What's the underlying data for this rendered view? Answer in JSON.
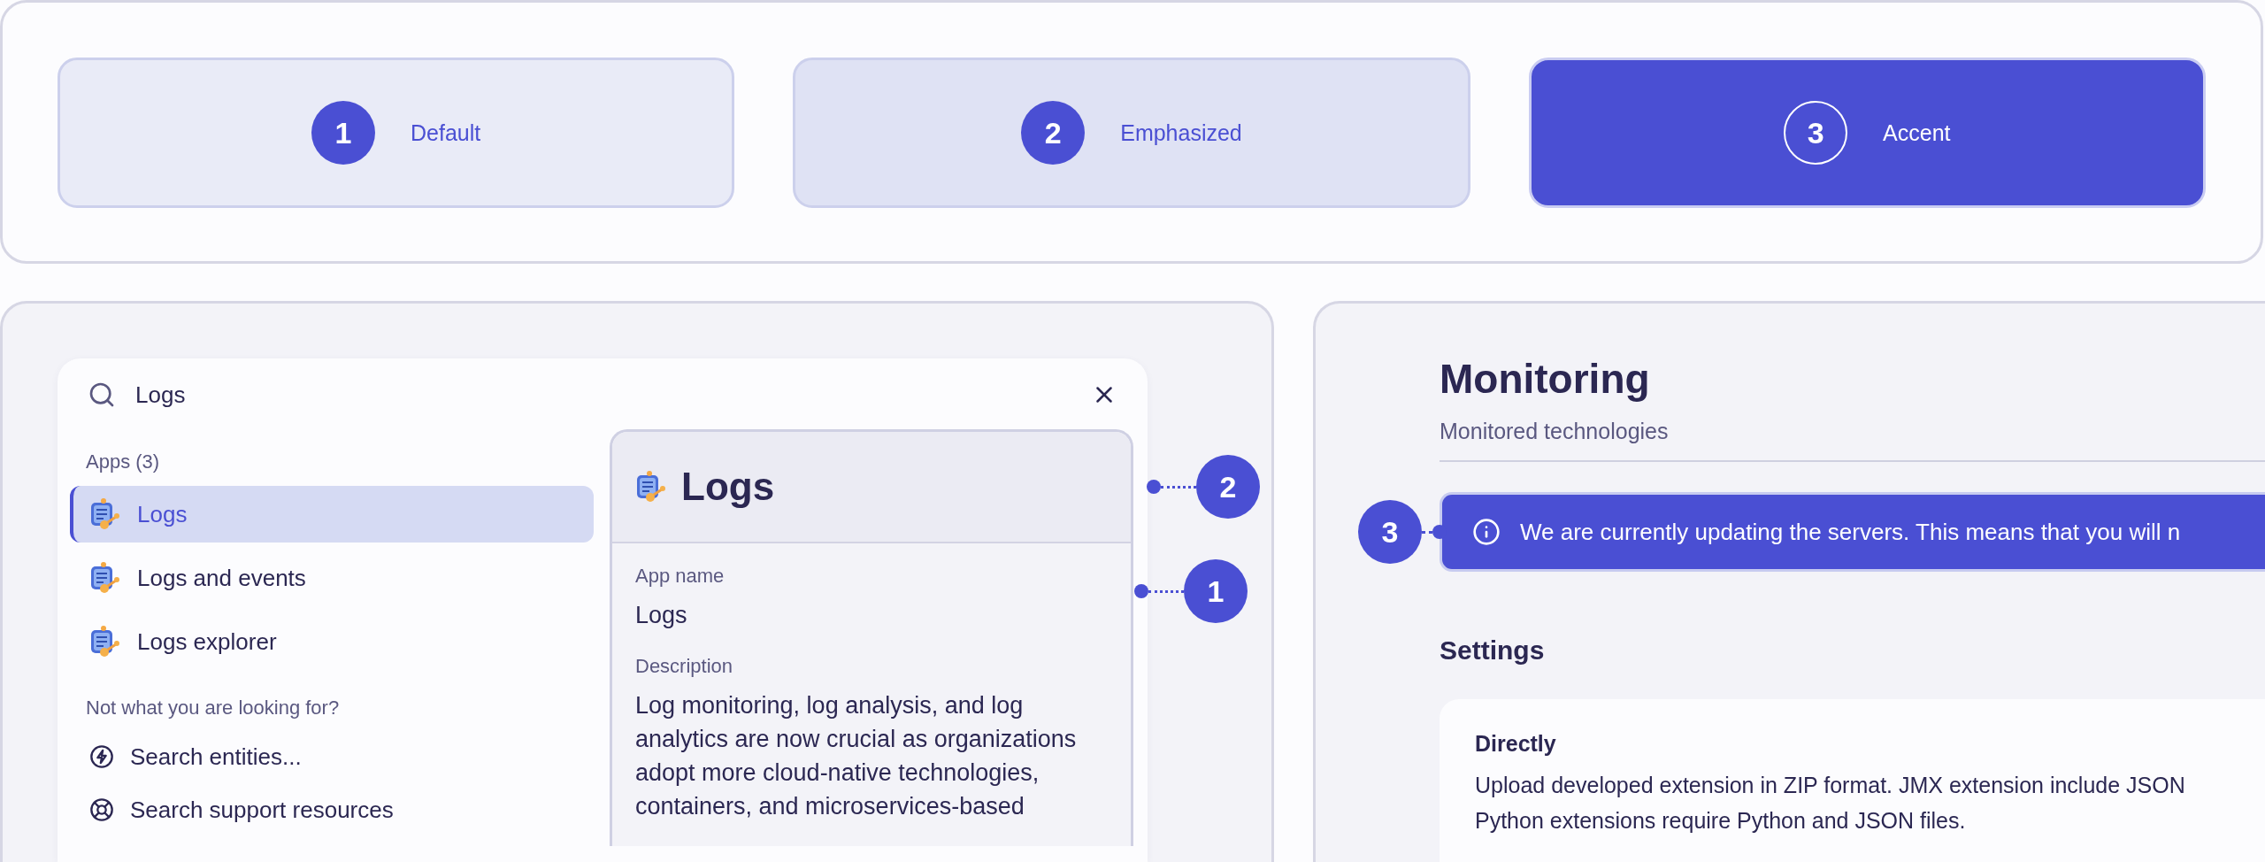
{
  "variants": [
    {
      "number": "1",
      "label": "Default",
      "kind": "default"
    },
    {
      "number": "2",
      "label": "Emphasized",
      "kind": "emphasized"
    },
    {
      "number": "3",
      "label": "Accent",
      "kind": "accent"
    }
  ],
  "search_dialog": {
    "query": "Logs",
    "section_title": "Apps (3)",
    "apps": [
      {
        "label": "Logs",
        "selected": true
      },
      {
        "label": "Logs and events",
        "selected": false
      },
      {
        "label": "Logs explorer",
        "selected": false
      }
    ],
    "fallback_title": "Not what you are looking for?",
    "actions": [
      {
        "label": "Search entities...",
        "kind": "entities"
      },
      {
        "label": "Search support resources",
        "kind": "support"
      }
    ]
  },
  "detail_card": {
    "title": "Logs",
    "callout": "2",
    "fields": [
      {
        "label": "App name",
        "value": "Logs",
        "callout": "1"
      },
      {
        "label": "Description",
        "value": "Log monitoring, log analysis, and log analytics are now crucial as organizations adopt more cloud-native technologies, containers, and microservices-based"
      }
    ]
  },
  "settings_page": {
    "title": "Monitoring",
    "subtitle": "Monitored technologies",
    "banner": {
      "text": "We are currently updating the servers. This means that you will n",
      "callout": "3"
    },
    "section_title": "Settings",
    "card": {
      "title": "Directly",
      "lines": [
        "Upload developed extension in ZIP format. JMX extension include JSON",
        "Python extensions require Python and JSON files."
      ]
    }
  }
}
